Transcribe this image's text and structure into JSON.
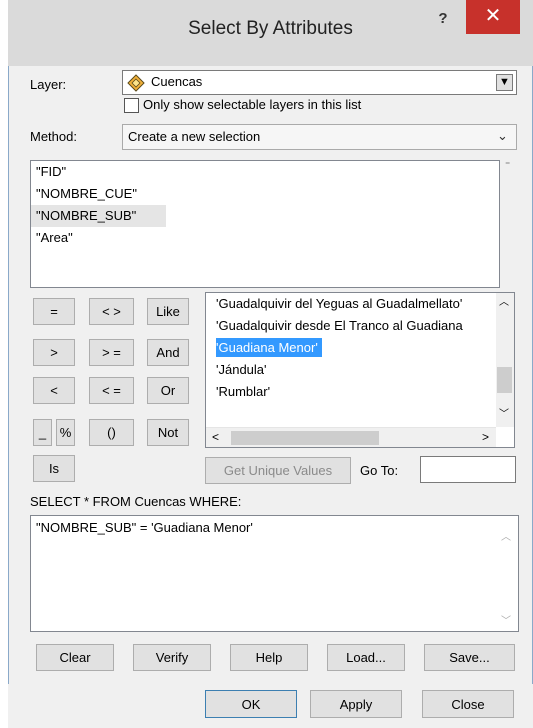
{
  "window": {
    "title": "Select By Attributes",
    "help": "?",
    "close": "✕"
  },
  "layer": {
    "label": "Layer:",
    "value": "Cuencas",
    "only_selectable": "Only show selectable layers in this list"
  },
  "method": {
    "label": "Method:",
    "value": "Create a new selection"
  },
  "fields": [
    "\"FID\"",
    "\"NOMBRE_CUE\"",
    "\"NOMBRE_SUB\"",
    "\"Area\""
  ],
  "operators": {
    "eq": "=",
    "ne": "< >",
    "like": "Like",
    "gt": ">",
    "ge": "> =",
    "and": "And",
    "lt": "<",
    "le": "< =",
    "or": "Or",
    "underscore": "_",
    "percent": "%",
    "parens": "()",
    "not": "Not",
    "is": "Is"
  },
  "values": [
    "'Guadalquivir del Yeguas al Guadalmellato'",
    "'Guadalquivir desde El Tranco al Guadiana",
    "'Guadiana Menor'",
    "'Jándula'",
    "'Rumblar'"
  ],
  "unique": {
    "button": "Get Unique Values",
    "goto_label": "Go To:",
    "goto_value": ""
  },
  "sql": {
    "prefix": "SELECT * FROM Cuencas WHERE:",
    "expression": "\"NOMBRE_SUB\" = 'Guadiana Menor'"
  },
  "actions": {
    "clear": "Clear",
    "verify": "Verify",
    "help": "Help",
    "load": "Load...",
    "save": "Save..."
  },
  "footer": {
    "ok": "OK",
    "apply": "Apply",
    "close": "Close"
  }
}
